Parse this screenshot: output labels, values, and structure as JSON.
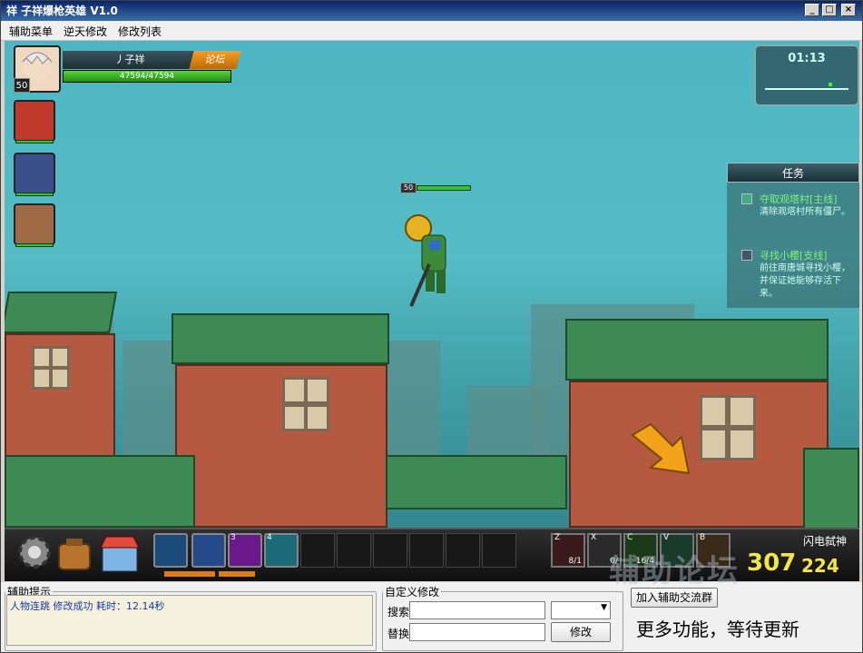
{
  "window": {
    "title": "祥 子祥爆枪英雄 V1.0",
    "min": "_",
    "max": "□",
    "close": "×"
  },
  "menu": [
    "辅助菜单",
    "逆天修改",
    "修改列表"
  ],
  "hud": {
    "player_level": "50",
    "player_name": "丿子祥",
    "forum_label": "论坛",
    "hp_text": "47594/47594",
    "hp_fraction": 1.0
  },
  "minimap": {
    "time": "01:13"
  },
  "quest": {
    "header": "任务",
    "items": [
      {
        "title": "夺取观塔村[主线]",
        "desc": "清除观塔村所有僵尸。",
        "checked": true
      },
      {
        "title": "寻找小樱[支线]",
        "desc": "前往南唐城寻找小樱，并保证她能够存活下来。",
        "checked": false
      }
    ]
  },
  "enemy": {
    "level": "50"
  },
  "skills": [
    {
      "key": "",
      "icon": "vortex-skill"
    },
    {
      "key": "",
      "icon": "gun-skill"
    },
    {
      "key": "3",
      "icon": "eye-skill"
    },
    {
      "key": "4",
      "icon": "fist-skill"
    }
  ],
  "items": [
    {
      "key": "Z",
      "count": "8/1",
      "icon": "potion-item"
    },
    {
      "key": "X",
      "count": "0/",
      "icon": "bag-item"
    },
    {
      "key": "C",
      "count": "16/4",
      "icon": "ammo-item"
    },
    {
      "key": "V",
      "count": "",
      "icon": "r-item"
    },
    {
      "key": "B",
      "count": "",
      "icon": "book-item"
    }
  ],
  "weapon": {
    "name": "闪电弑神",
    "ammo": "307",
    "clip": "224"
  },
  "helper": {
    "legend": "辅助提示",
    "message": "人物连跳 修改成功 耗时：12.14秒"
  },
  "custom": {
    "legend": "自定义修改",
    "search_label": "搜索",
    "replace_label": "替换",
    "modify_button": "修改"
  },
  "join_button": "加入辅助交流群",
  "more_text": "更多功能，等待更新",
  "watermark": "辅助论坛"
}
